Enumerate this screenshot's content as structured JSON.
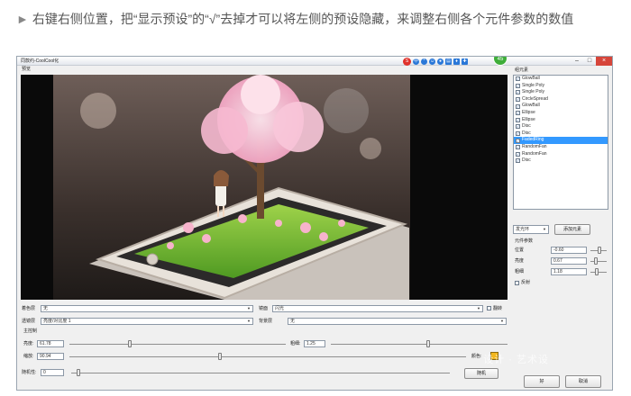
{
  "intro": {
    "bullet": "►",
    "text": "右键右侧位置，把“显示预设”的“√”去掉才可以将左侧的预设隐藏，来调整右侧各个元件参数的数值"
  },
  "window": {
    "title": "同款约-CoolCool化",
    "controls": {
      "minimize": "–",
      "maximize": "□",
      "close": "×"
    }
  },
  "tray": {
    "avatar_text": "45"
  },
  "preview_label": "预览",
  "sidebar": {
    "elements_label": "组元素",
    "elements": [
      {
        "label": "GlowBall",
        "checked": true,
        "selected": false
      },
      {
        "label": "Single Poly",
        "checked": true,
        "selected": false
      },
      {
        "label": "Single Poly",
        "checked": true,
        "selected": false
      },
      {
        "label": "CircleSpread",
        "checked": true,
        "selected": false
      },
      {
        "label": "GlowBall",
        "checked": true,
        "selected": false
      },
      {
        "label": "Ellipse",
        "checked": true,
        "selected": false
      },
      {
        "label": "Ellipse",
        "checked": true,
        "selected": false
      },
      {
        "label": "Disc",
        "checked": true,
        "selected": false
      },
      {
        "label": "Disc",
        "checked": true,
        "selected": false
      },
      {
        "label": "FadedRing",
        "checked": true,
        "selected": true
      },
      {
        "label": "RandomFan",
        "checked": true,
        "selected": false
      },
      {
        "label": "RandomFan",
        "checked": true,
        "selected": false
      },
      {
        "label": "Disc",
        "checked": true,
        "selected": false
      }
    ],
    "element_type": "发光环",
    "add_element_button": "添加元素",
    "params_label": "元件参数",
    "params": [
      {
        "label": "位置",
        "value": "-0.60",
        "fraction": 0.55
      },
      {
        "label": "亮度",
        "value": "0.67",
        "fraction": 0.35
      },
      {
        "label": "粗细",
        "value": "1.18",
        "fraction": 0.4
      }
    ],
    "flip_label": "反射",
    "ok_button": "好",
    "cancel_button": "取消"
  },
  "bottom": {
    "tint_label": "着色层",
    "tint_value": "无",
    "lens_label": "镜面",
    "lens_value": "闪光",
    "flip_label": "翻转",
    "texture_label": "透镜层",
    "texture_value": "亮度/对比度 1",
    "bg_label": "背景层",
    "bg_value": "无",
    "main_label": "主控制",
    "brightness": {
      "label": "亮度:",
      "value": "61.78",
      "fraction": 0.28
    },
    "thickness": {
      "label": "粗细:",
      "value": "1.25",
      "fraction": 0.55
    },
    "scale": {
      "label": "缩放:",
      "value": "90.94",
      "fraction": 0.38
    },
    "color_label": "颜色:",
    "color": "#f2b61c",
    "random_label": "随机性:",
    "random_value": "0",
    "random_fraction": 0.02,
    "random_button": "随机"
  },
  "watermark": "设计 · 艺术设"
}
